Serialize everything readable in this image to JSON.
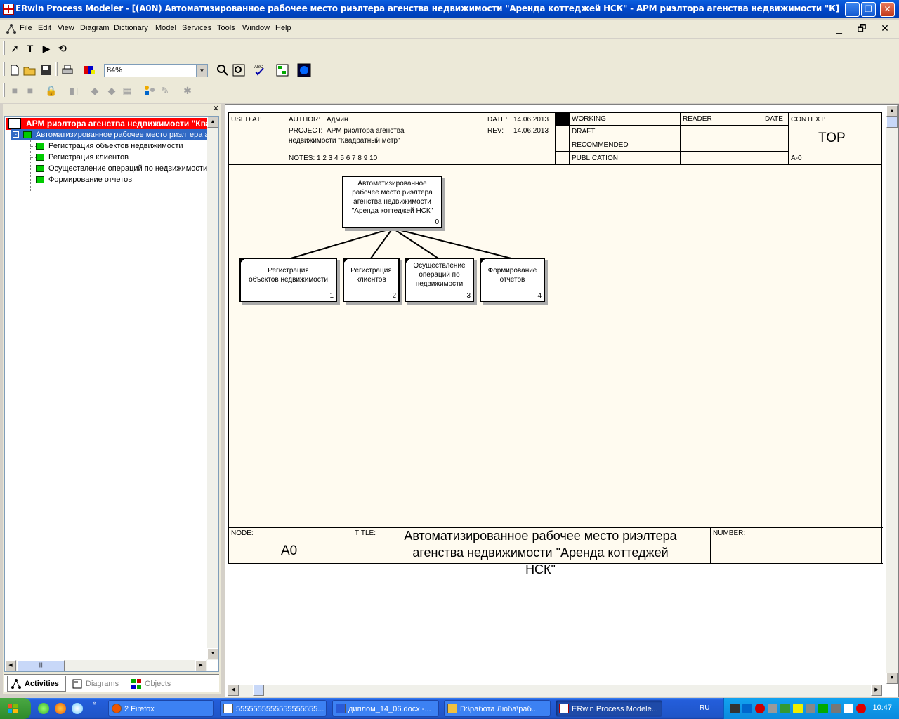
{
  "window": {
    "title": "ERwin Process Modeler - [(A0N) Автоматизированное  рабочее место риэлтера агенства недвижимости \"Аренда коттеджей НСК\" - АРМ риэлтора агенства недвижимости \"К]",
    "min": "_",
    "max": "❐",
    "close": "✕"
  },
  "menu": {
    "items": [
      "File",
      "Edit",
      "View",
      "Diagram",
      "Dictionary",
      "Model",
      "Services",
      "Tools",
      "Window",
      "Help"
    ],
    "mdi_min": "_",
    "mdi_restore": "🗗",
    "mdi_close": "✕"
  },
  "toolbar": {
    "zoom_value": "84%",
    "pointer": "➚",
    "text_tool": "T",
    "play": "▶",
    "undo": "⟲"
  },
  "left_panel": {
    "close": "✕",
    "root_label": "АРМ риэлтора агенства недвижимости \"Квадратный метр\"",
    "selected_label": "Автоматизированное  рабочее место риэлтера агенства недвижимости \"Аренда коттеджей НСК\"",
    "children": [
      "Регистрация объектов недвижимости",
      "Регистрация клиентов",
      "Осуществление операций по  недвижимости",
      "Формирование отчетов"
    ],
    "tabs": [
      "Activities",
      "Diagrams",
      "Objects"
    ]
  },
  "frame": {
    "used_at": "USED AT:",
    "author_label": "AUTHOR:",
    "author": "Админ",
    "project_label": "PROJECT:",
    "project_line1": "АРМ риэлтора агенства",
    "project_line2": "недвижимости \"Квадратный метр\"",
    "notes": "NOTES:  1  2  3  4  5  6  7  8  9  10",
    "date_label": "DATE:",
    "date": "14.06.2013",
    "rev_label": "REV:",
    "rev": "14.06.2013",
    "status": [
      "WORKING",
      "DRAFT",
      "RECOMMENDED",
      "PUBLICATION"
    ],
    "reader": "READER",
    "reader_date": "DATE",
    "context": "CONTEXT:",
    "context_value": "TOP",
    "context_node": "A-0",
    "node_label": "NODE:",
    "node": "A0",
    "title_label": "TITLE:",
    "title_line1": "Автоматизированное  рабочее место риэлтера",
    "title_line2": "агенства недвижимости \"Аренда коттеджей",
    "title_line3": "НСК\"",
    "number_label": "NUMBER:"
  },
  "diagram": {
    "parent": {
      "lines": [
        "Автоматизированное",
        "рабочее место риэлтера",
        "агенства недвижимости",
        "\"Аренда коттеджей НСК\""
      ],
      "num": "0"
    },
    "children": [
      {
        "lines": [
          "Регистрация",
          "объектов недвижимости"
        ],
        "num": "1"
      },
      {
        "lines": [
          "Регистрация",
          "клиентов"
        ],
        "num": "2"
      },
      {
        "lines": [
          "Осуществление",
          "операций по",
          "недвижимости"
        ],
        "num": "3"
      },
      {
        "lines": [
          "Формирование",
          "отчетов"
        ],
        "num": "4"
      }
    ]
  },
  "taskbar": {
    "tasks": [
      "2 Firefox",
      "5555555555555555555...",
      "диплом_14_06.docx -...",
      "D:\\работа Люба\\раб...",
      "ERwin Process Modele..."
    ],
    "lang": "RU",
    "clock": "10:47"
  }
}
